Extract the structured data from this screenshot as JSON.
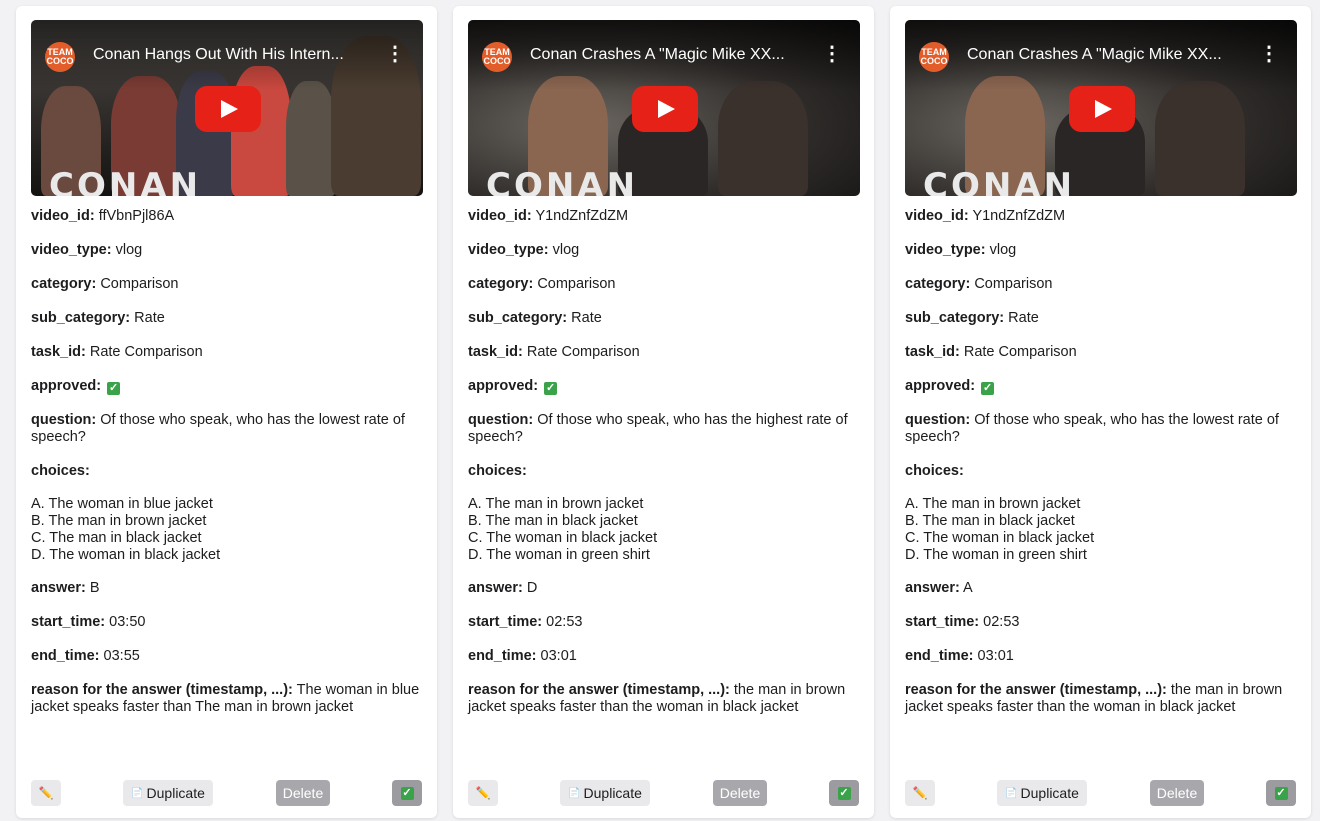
{
  "labels": {
    "video_id": "video_id:",
    "video_type": "video_type:",
    "category": "category:",
    "sub_category": "sub_category:",
    "task_id": "task_id:",
    "approved": "approved:",
    "question": "question:",
    "choices": "choices:",
    "answer": "answer:",
    "start_time": "start_time:",
    "end_time": "end_time:",
    "reason": "reason for the answer (timestamp, ...):"
  },
  "buttons": {
    "edit_icon": "✏️",
    "duplicate_icon": "📄",
    "duplicate": "Duplicate",
    "delete": "Delete",
    "approve_icon": "✓"
  },
  "icons": {
    "approved": "white-check-mark-icon",
    "edit": "pencil-icon",
    "duplicate": "page-icon",
    "play": "youtube-play-icon"
  },
  "colors": {
    "check": "#3aa34a",
    "play": "#e62117",
    "channel_logo": "#e35d2a"
  },
  "cards": [
    {
      "video": {
        "channel_logo": "TEAM COCO",
        "channel_line1": "TEAM",
        "channel_line2": "COCO",
        "title": "Conan Hangs Out With His Intern...",
        "kebab": "⋮",
        "wordmark": "CONAN"
      },
      "video_id": "ffVbnPjl86A",
      "video_type": "vlog",
      "category": "Comparison",
      "sub_category": "Rate",
      "task_id": "Rate Comparison",
      "approved_mark": "✓",
      "question": "Of those who speak, who has the lowest rate of speech?",
      "choices": [
        "A. The woman in blue jacket",
        "B. The man in brown jacket",
        "C. The man in black jacket",
        "D. The woman in black jacket"
      ],
      "answer": "B",
      "start_time": "03:50",
      "end_time": "03:55",
      "reason": "The woman in blue jacket speaks faster than The man in brown jacket"
    },
    {
      "video": {
        "channel_logo": "TEAM COCO",
        "channel_line1": "TEAM",
        "channel_line2": "COCO",
        "title": "Conan Crashes A \"Magic Mike XX...",
        "kebab": "⋮",
        "wordmark": "CONAN"
      },
      "video_id": "Y1ndZnfZdZM",
      "video_type": "vlog",
      "category": "Comparison",
      "sub_category": "Rate",
      "task_id": "Rate Comparison",
      "approved_mark": "✓",
      "question": "Of those who speak, who has the highest rate of speech?",
      "choices": [
        "A. The man in brown jacket",
        "B. The man in black jacket",
        "C. The woman in black jacket",
        "D. The woman in green shirt"
      ],
      "answer": "D",
      "start_time": "02:53",
      "end_time": "03:01",
      "reason": "the man in brown jacket speaks faster than the woman in black jacket"
    },
    {
      "video": {
        "channel_logo": "TEAM COCO",
        "channel_line1": "TEAM",
        "channel_line2": "COCO",
        "title": "Conan Crashes A \"Magic Mike XX...",
        "kebab": "⋮",
        "wordmark": "CONAN"
      },
      "video_id": "Y1ndZnfZdZM",
      "video_type": "vlog",
      "category": "Comparison",
      "sub_category": "Rate",
      "task_id": "Rate Comparison",
      "approved_mark": "✓",
      "question": "Of those who speak, who has the lowest rate of speech?",
      "choices": [
        "A. The man in brown jacket",
        "B. The man in black jacket",
        "C. The woman in black jacket",
        "D. The woman in green shirt"
      ],
      "answer": "A",
      "start_time": "02:53",
      "end_time": "03:01",
      "reason": "the man in brown jacket speaks faster than the woman in black jacket"
    }
  ]
}
